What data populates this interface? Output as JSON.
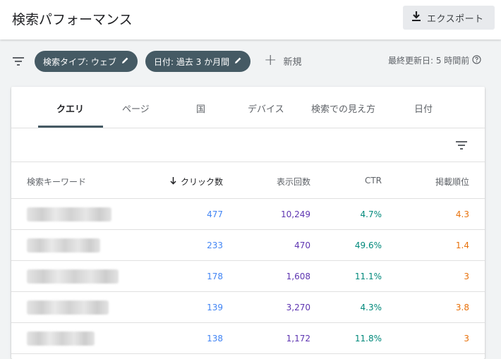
{
  "header": {
    "title": "検索パフォーマンス",
    "export_label": "エクスポート"
  },
  "filters": {
    "chips": [
      {
        "label": "検索タイプ: ウェブ"
      },
      {
        "label": "日付: 過去 3 か月間"
      }
    ],
    "new_label": "新規",
    "updated_label": "最終更新日: 5 時間前"
  },
  "tabs": [
    {
      "label": "クエリ",
      "active": true
    },
    {
      "label": "ページ"
    },
    {
      "label": "国"
    },
    {
      "label": "デバイス"
    },
    {
      "label": "検索での見え方"
    },
    {
      "label": "日付"
    }
  ],
  "table": {
    "columns": {
      "query": "検索キーワード",
      "clicks": "クリック数",
      "impressions": "表示回数",
      "ctr": "CTR",
      "position": "掲載順位"
    },
    "sort_icon": "arrow-down-icon",
    "rows": [
      {
        "query_redacted": true,
        "clicks": "477",
        "impressions": "10,249",
        "ctr": "4.7%",
        "position": "4.3"
      },
      {
        "query_redacted": true,
        "clicks": "233",
        "impressions": "470",
        "ctr": "49.6%",
        "position": "1.4"
      },
      {
        "query_redacted": true,
        "clicks": "178",
        "impressions": "1,608",
        "ctr": "11.1%",
        "position": "3"
      },
      {
        "query_redacted": true,
        "clicks": "139",
        "impressions": "3,270",
        "ctr": "4.3%",
        "position": "3.8"
      },
      {
        "query_redacted": true,
        "clicks": "138",
        "impressions": "1,172",
        "ctr": "11.8%",
        "position": "3"
      }
    ]
  },
  "colors": {
    "chip_bg": "#455a64",
    "clicks": "#4285f4",
    "impressions": "#5e35b1",
    "ctr": "#00897b",
    "position": "#e8710a"
  }
}
